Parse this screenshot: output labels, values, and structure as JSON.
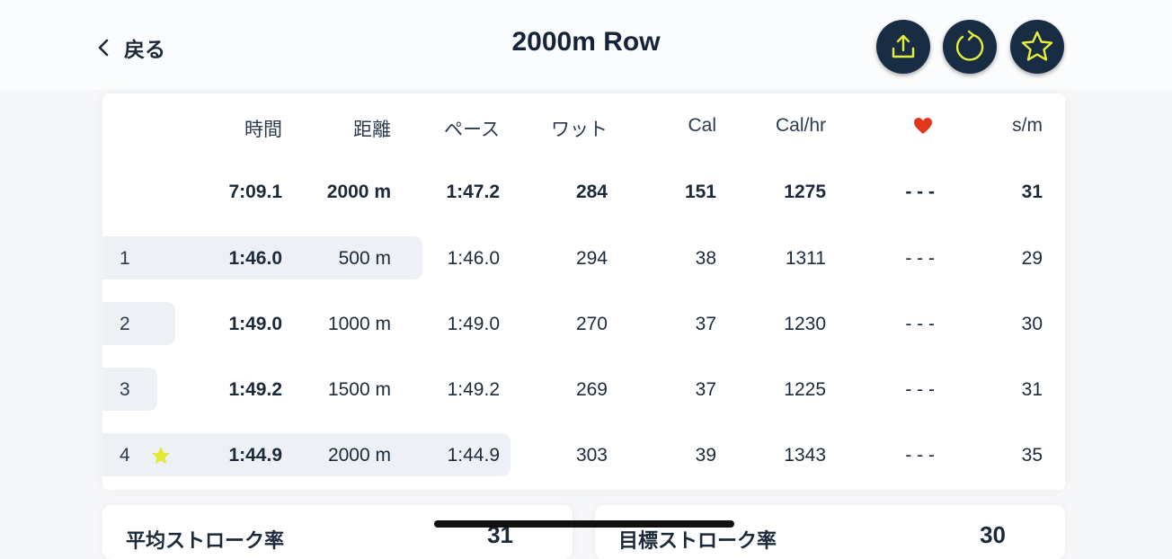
{
  "header": {
    "back_label": "戻る",
    "title": "2000m Row",
    "actions": [
      "upload-icon",
      "refresh-icon",
      "star-icon"
    ]
  },
  "colors": {
    "button_bg": "#182c44",
    "button_icon": "#e6ee3a",
    "highlight": "#edf1f5",
    "heart": "#e2371d",
    "lap_star": "#e2e835"
  },
  "table": {
    "headers": [
      "時間",
      "距離",
      "ペース",
      "ワット",
      "Cal",
      "Cal/hr",
      "heart-icon",
      "s/m"
    ],
    "total": [
      "7:09.1",
      "2000 m",
      "1:47.2",
      "284",
      "151",
      "1275",
      "- - -",
      "31"
    ],
    "laps": [
      {
        "num": "1",
        "cells": [
          "1:46.0",
          "500 m",
          "1:46.0",
          "294",
          "38",
          "1311",
          "- - -",
          "29"
        ]
      },
      {
        "num": "2",
        "cells": [
          "1:49.0",
          "1000 m",
          "1:49.0",
          "270",
          "37",
          "1230",
          "- - -",
          "30"
        ]
      },
      {
        "num": "3",
        "cells": [
          "1:49.2",
          "1500 m",
          "1:49.2",
          "269",
          "37",
          "1225",
          "- - -",
          "31"
        ]
      },
      {
        "num": "4",
        "cells": [
          "1:44.9",
          "2000 m",
          "1:44.9",
          "303",
          "39",
          "1343",
          "- - -",
          "35"
        ],
        "best": true
      }
    ]
  },
  "bottom_cards": [
    {
      "label": "平均ストローク率",
      "value": "31"
    },
    {
      "label": "目標ストローク率",
      "value": "30"
    }
  ]
}
